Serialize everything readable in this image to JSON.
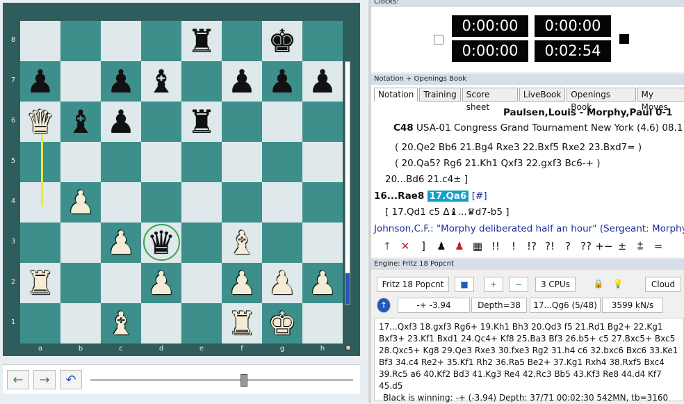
{
  "board": {
    "ranks": [
      "8",
      "7",
      "6",
      "5",
      "4",
      "3",
      "2",
      "1"
    ],
    "files": [
      "a",
      "b",
      "c",
      "d",
      "e",
      "f",
      "g",
      "h"
    ],
    "position": [
      [
        "",
        "",
        "",
        "",
        "bR",
        "",
        "bK",
        ""
      ],
      [
        "bP",
        "",
        "bP",
        "bB",
        "",
        "bP",
        "bP",
        "bP"
      ],
      [
        "wQ",
        "bB",
        "bP",
        "",
        "bR",
        "",
        "",
        ""
      ],
      [
        "",
        "",
        "",
        "",
        "",
        "",
        "",
        ""
      ],
      [
        "",
        "wP",
        "",
        "",
        "",
        "",
        "",
        ""
      ],
      [
        "",
        "",
        "wP",
        "bQ",
        "",
        "wB",
        "",
        ""
      ],
      [
        "wR",
        "",
        "",
        "wP",
        "",
        "wP",
        "wP",
        "wP"
      ],
      [
        "",
        "",
        "wB",
        "",
        "",
        "wR",
        "wK",
        ""
      ]
    ],
    "piece_glyphs": {
      "K": "♚",
      "Q": "♛",
      "R": "♜",
      "B": "♝",
      "N": "♞",
      "P": "♟"
    }
  },
  "nav": {
    "back": "←",
    "forward": "→",
    "undo": "↶"
  },
  "clocks": {
    "title": "Clocks:",
    "top_left": "0:00:00",
    "top_right": "0:00:00",
    "bottom_left": "0:00:00",
    "bottom_right": "0:02:54"
  },
  "notation": {
    "title": "Notation + Openings Book",
    "tabs": [
      "Notation",
      "Training",
      "Score sheet",
      "LiveBook",
      "Openings Book",
      "My Moves"
    ],
    "players": "Paulsen,Louis - Morphy,Paul  0-1",
    "eco": "C48",
    "event": "USA-01 Congress Grand Tournament New York (4.6) 08.11.",
    "line1": "( 20.Qe2  Bb6  21.Bg4  Rxe3  22.Bxf5  Rxe2  23.Bxd7= )",
    "line2": "( 20.Qa5?  Rg6  21.Kh1  Qxf3  22.gxf3  Bc6-+ )",
    "line3": "20...Bd6  21.c4± ]",
    "line4_prefix": "16...Rae8",
    "line4_move": "17.Qa6",
    "line4_suffix": "[#]",
    "line5": "[ 17.Qd1  c5  Δ♝...♛d7-b5 ]",
    "comment": "Johnson,C.F.: \"Morphy deliberated half an hour\" (Sergeant: Morphy C",
    "toolbar": [
      "↑",
      "✕",
      "]",
      "♟",
      "♟",
      "▦",
      "!!",
      "!",
      "!?",
      "?!",
      "?",
      "??",
      "+−",
      "±",
      "⩲",
      "="
    ]
  },
  "engine": {
    "title": "Engine: Fritz 18 Popcnt",
    "name": "Fritz 18 Popcnt",
    "stop_icon": "■",
    "zoom_in": "+",
    "zoom_out": "−",
    "cpus": "3 CPUs",
    "lock": "🔒",
    "bulb": "💡",
    "cloud": "Cloud",
    "up_icon": "↑",
    "eval": "-+ -3.94",
    "depth": "Depth=38",
    "curmove": "17...Qg6 (5/48)",
    "speed": "3599 kN/s",
    "pv": "17...Qxf3 18.gxf3 Rg6+ 19.Kh1 Bh3 20.Qd3 f5 21.Rd1 Bg2+ 22.Kg1 Bxf3+ 23.Kf1 Bxd1 24.Qc4+ Kf8 25.Ba3 Bf3 26.b5+ c5 27.Bxc5+ Bxc5 28.Qxc5+ Kg8 29.Qe3 Rxe3 30.fxe3 Rg2 31.h4 c6 32.bxc6 Bxc6 33.Ke1 Bf3 34.c4 Re2+ 35.Kf1 Rh2 36.Ra5 Be2+ 37.Kg1 Rxh4 38.Rxf5 Bxc4 39.Rc5 a6 40.Kf2 Bd3 41.Kg3 Re4 42.Rc3 Bb5 43.Kf3 Re8 44.d4 Kf7 45.d5",
    "status": "Black is winning: -+ (-3.94)  Depth: 37/71   00:02:30  542MN, tb=3160"
  }
}
